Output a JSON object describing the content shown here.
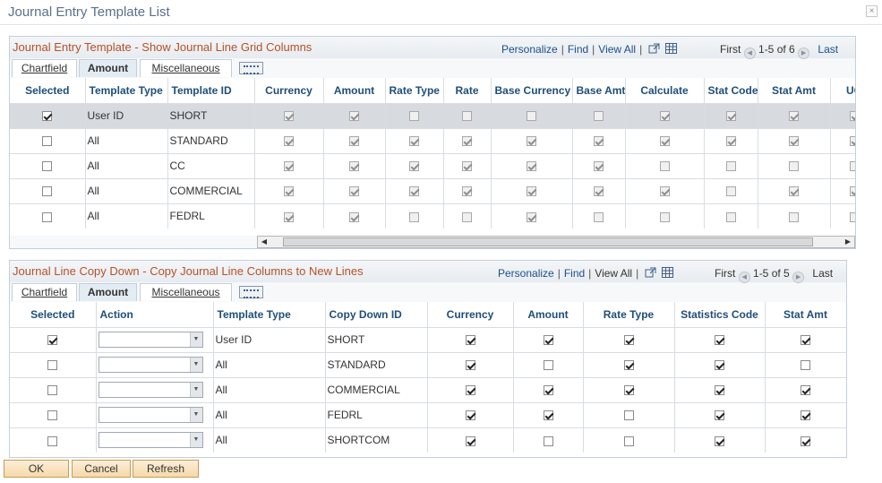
{
  "window": {
    "title": "Journal Entry Template List",
    "close_glyph": "×"
  },
  "grid1": {
    "title": "Journal Entry Template - Show Journal Line Grid Columns",
    "nav": {
      "personalize": "Personalize",
      "find": "Find",
      "view_all": "View All",
      "first": "First",
      "range": "1-5 of 6",
      "last": "Last"
    },
    "tabs": [
      "Chartfield",
      "Amount",
      "Miscellaneous"
    ],
    "active_tab": "Amount",
    "columns": [
      "Selected",
      "Template Type",
      "Template ID",
      "Currency",
      "Amount",
      "Rate Type",
      "Rate",
      "Base Currency",
      "Base Amt",
      "Calculate",
      "Stat Code",
      "Stat Amt",
      "UO"
    ],
    "rows": [
      {
        "selected": true,
        "type": "User ID",
        "id": "SHORT",
        "checks": [
          true,
          true,
          false,
          false,
          false,
          false,
          true,
          true,
          true,
          true
        ]
      },
      {
        "selected": false,
        "type": "All",
        "id": "STANDARD",
        "checks": [
          true,
          true,
          true,
          true,
          true,
          true,
          true,
          true,
          true,
          true
        ]
      },
      {
        "selected": false,
        "type": "All",
        "id": "CC",
        "checks": [
          true,
          true,
          true,
          true,
          true,
          true,
          false,
          false,
          false,
          false
        ]
      },
      {
        "selected": false,
        "type": "All",
        "id": "COMMERCIAL",
        "checks": [
          true,
          true,
          true,
          true,
          true,
          true,
          true,
          false,
          true,
          true
        ]
      },
      {
        "selected": false,
        "type": "All",
        "id": "FEDRL",
        "checks": [
          true,
          true,
          false,
          false,
          true,
          false,
          false,
          false,
          false,
          false
        ]
      }
    ]
  },
  "grid2": {
    "title": "Journal Line Copy Down - Copy Journal Line Columns to New Lines",
    "nav": {
      "personalize": "Personalize",
      "find": "Find",
      "view_all": "View All",
      "first": "First",
      "range": "1-5 of 5",
      "last": "Last"
    },
    "tabs": [
      "Chartfield",
      "Amount",
      "Miscellaneous"
    ],
    "active_tab": "Amount",
    "columns": [
      "Selected",
      "Action",
      "Template Type",
      "Copy Down ID",
      "Currency",
      "Amount",
      "Rate Type",
      "Statistics Code",
      "Stat Amt"
    ],
    "rows": [
      {
        "selected": true,
        "action": "",
        "type": "User ID",
        "id": "SHORT",
        "checks": [
          true,
          true,
          true,
          true,
          true
        ]
      },
      {
        "selected": false,
        "action": "",
        "type": "All",
        "id": "STANDARD",
        "checks": [
          true,
          false,
          true,
          true,
          false
        ]
      },
      {
        "selected": false,
        "action": "",
        "type": "All",
        "id": "COMMERCIAL",
        "checks": [
          true,
          true,
          true,
          true,
          true
        ]
      },
      {
        "selected": false,
        "action": "",
        "type": "All",
        "id": "FEDRL",
        "checks": [
          true,
          true,
          false,
          true,
          true
        ]
      },
      {
        "selected": false,
        "action": "",
        "type": "All",
        "id": "SHORTCOM",
        "checks": [
          true,
          false,
          false,
          true,
          true
        ]
      }
    ]
  },
  "buttons": {
    "ok": "OK",
    "cancel": "Cancel",
    "refresh": "Refresh"
  },
  "colors": {
    "title": "#5a6f8c",
    "panel_title": "#b3512a",
    "link": "#1a4f8c",
    "header_text": "#1f4e79",
    "button_bg": "#f5d9a8"
  }
}
